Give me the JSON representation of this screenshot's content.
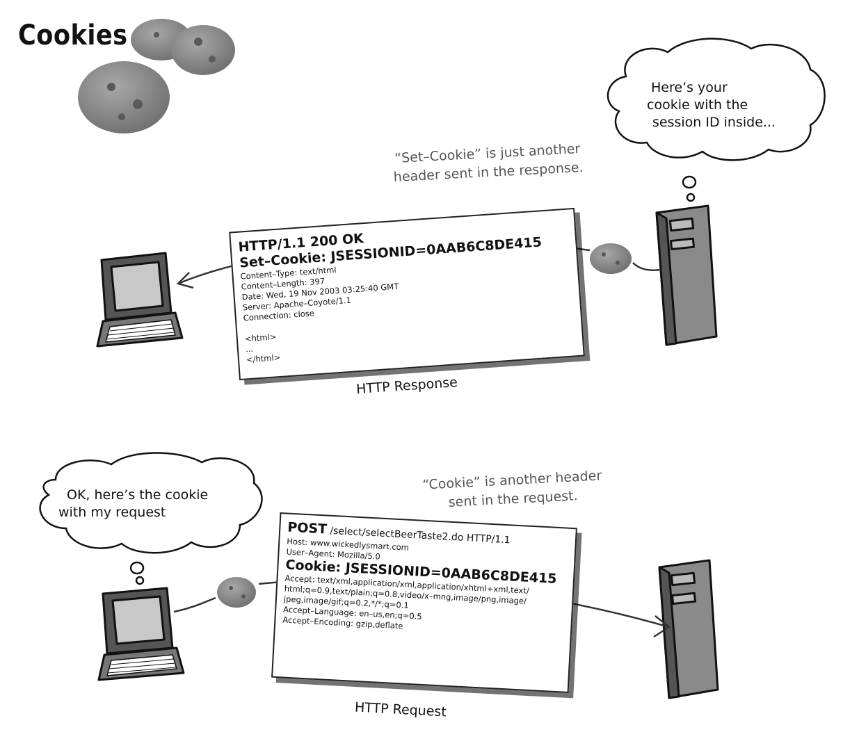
{
  "title": "Cookies",
  "response_section": {
    "note_lines": [
      "“Set–Cookie” is just another",
      "header sent in the response."
    ],
    "server_bubble_lines": [
      "Here’s your",
      "cookie with the",
      "session ID inside..."
    ],
    "card": {
      "status_line": "HTTP/1.1 200 OK",
      "set_cookie_line": "Set–Cookie: JSESSIONID=0AAB6C8DE415",
      "header_lines": [
        "Content–Type: text/html",
        "Content–Length: 397",
        "Date: Wed, 19 Nov 2003 03:25:40 GMT",
        "Server: Apache–Coyote/1.1",
        "Connection: close"
      ],
      "body_lines": [
        "<html>",
        "...",
        " </html>"
      ]
    },
    "caption": "HTTP Response"
  },
  "request_section": {
    "note_lines": [
      "“Cookie” is another header",
      "sent in the request."
    ],
    "client_bubble_lines": [
      "OK, here’s the cookie",
      "with my request"
    ],
    "card": {
      "method": "POST",
      "request_target": " /select/selectBeerTaste2.do  HTTP/1.1",
      "header_lines_before": [
        "Host: www.wickedlysmart.com",
        "User–Agent: Mozilla/5.0"
      ],
      "cookie_line": "Cookie: JSESSIONID=0AAB6C8DE415",
      "header_lines_after": [
        "Accept: text/xml,application/xml,application/xhtml+xml,text/",
        "html;q=0.9,text/plain;q=0.8,video/x–mng,image/png,image/",
        "jpeg,image/gif;q=0.2,*/*;q=0.1",
        "Accept–Language: en–us,en;q=0.5",
        "Accept–Encoding: gzip,deflate"
      ]
    },
    "caption": "HTTP Request"
  },
  "colors": {
    "ink": "#111111",
    "note_gray": "#555555",
    "cookie_gray": "#8c8c8c",
    "server_gray": "#8a8a8a",
    "screen_gray": "#c8c8c8"
  },
  "icons": [
    "cookies-image",
    "laptop-icon",
    "server-icon",
    "cookie-icon",
    "thought-bubble"
  ]
}
